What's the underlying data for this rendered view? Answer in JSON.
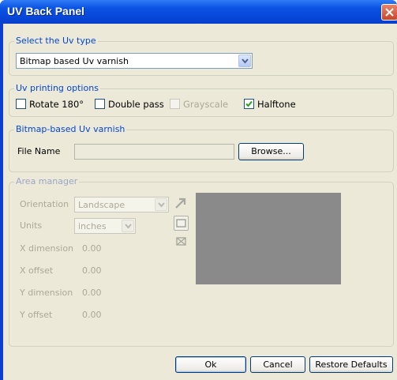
{
  "window": {
    "title": "UV Back Panel"
  },
  "uv_type": {
    "legend": "Select the Uv type",
    "selected": "Bitmap based Uv varnish"
  },
  "printing_options": {
    "legend": "Uv printing options",
    "rotate": {
      "label": "Rotate 180°",
      "checked": false
    },
    "double_pass": {
      "label": "Double pass",
      "checked": false
    },
    "grayscale": {
      "label": "Grayscale",
      "checked": false,
      "enabled": false
    },
    "halftone": {
      "label": "Halftone",
      "checked": true
    }
  },
  "bitmap_varnish": {
    "legend": "Bitmap-based Uv varnish",
    "file_name_label": "File Name",
    "file_name_value": "",
    "browse_label": "Browse..."
  },
  "area_manager": {
    "legend": "Area manager",
    "orientation_label": "Orientation",
    "orientation_value": "Landscape",
    "units_label": "Units",
    "units_value": "inches",
    "x_dimension_label": "X dimension",
    "x_dimension_value": "0.00",
    "x_offset_label": "X offset",
    "x_offset_value": "0.00",
    "y_dimension_label": "Y dimension",
    "y_dimension_value": "0.00",
    "y_offset_label": "Y offset",
    "y_offset_value": "0.00",
    "tools": [
      "arrow-icon",
      "rectangle-icon",
      "delete-area-icon"
    ]
  },
  "footer": {
    "ok_label": "Ok",
    "cancel_label": "Cancel",
    "restore_label": "Restore Defaults"
  },
  "colors": {
    "title_bar": "#0a52e3",
    "dialog_bg": "#ece9d8",
    "group_legend": "#0046d5",
    "preview_fill": "#8a8a8a"
  }
}
